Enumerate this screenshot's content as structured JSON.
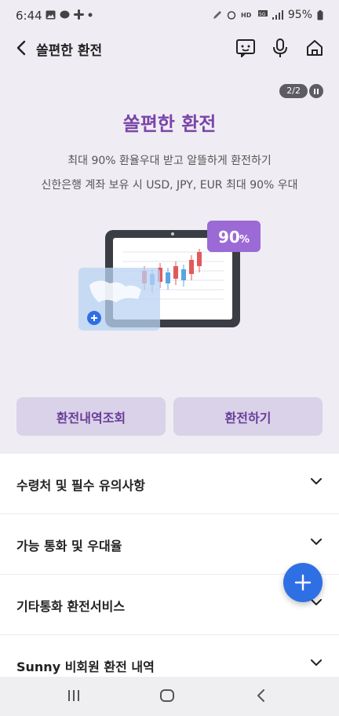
{
  "status": {
    "time": "6:44",
    "battery": "95%"
  },
  "appbar": {
    "title": "쏠편한 환전"
  },
  "hero": {
    "page_indicator": "2/2",
    "title": "쏠편한 환전",
    "desc_line1": "최대 90% 환율우대 받고 알뜰하게 환전하기",
    "desc_line2": "신한은행 계좌 보유 시 USD, JPY, EUR 최대 90% 우대",
    "badge": "90",
    "badge_unit": "%"
  },
  "buttons": {
    "history": "환전내역조회",
    "exchange": "환전하기"
  },
  "accordion": [
    {
      "label": "수령처 및 필수 유의사항"
    },
    {
      "label": "가능 통화 및 우대율"
    },
    {
      "label": "기타통화 환전서비스"
    },
    {
      "label": "Sunny 비회원 환전 내역"
    }
  ],
  "colors": {
    "accent": "#7a45a8",
    "button_bg": "#d9d2e8",
    "fab": "#2f6fe4",
    "hero_bg": "#efedf3"
  },
  "icons": [
    "back-icon",
    "chatbot-icon",
    "mic-icon",
    "home-icon",
    "pause-icon",
    "chevron-down-icon",
    "plus-icon"
  ]
}
